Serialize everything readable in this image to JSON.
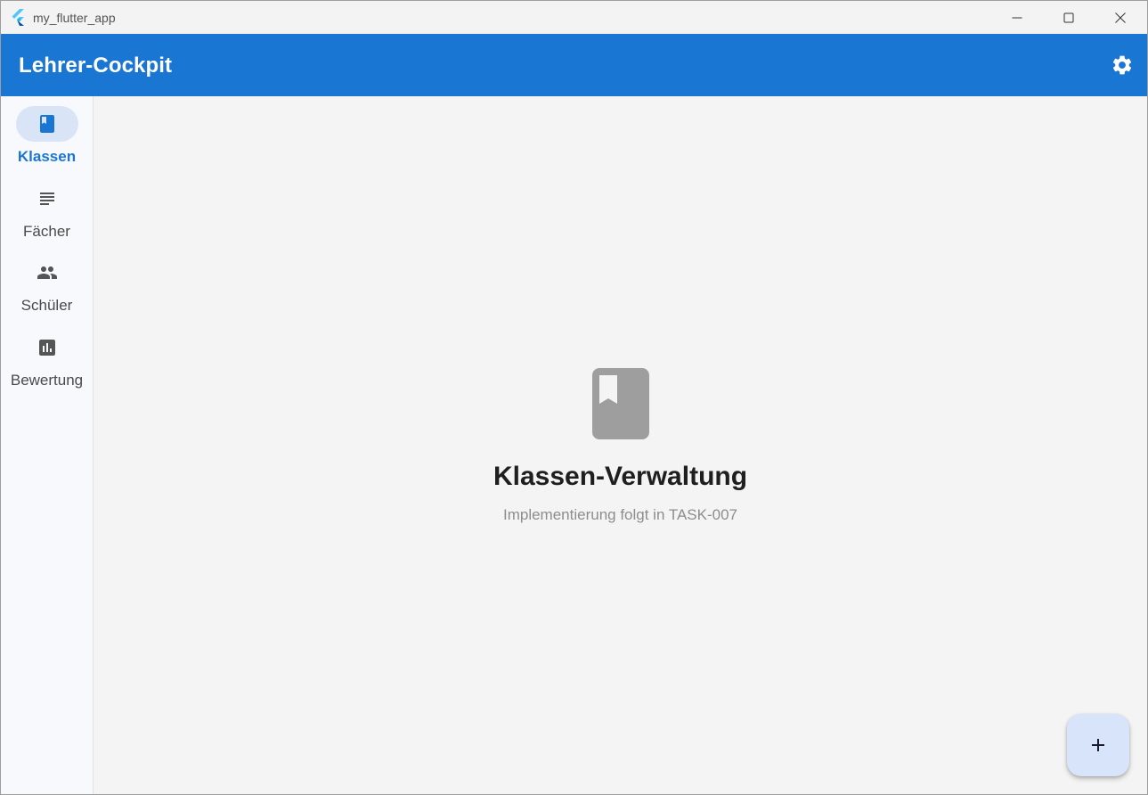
{
  "window": {
    "title": "my_flutter_app"
  },
  "appbar": {
    "title": "Lehrer-Cockpit",
    "settings_icon": "gear-icon",
    "color": "#1976d2"
  },
  "rail": {
    "items": [
      {
        "label": "Klassen",
        "icon": "book-icon",
        "active": true
      },
      {
        "label": "Fächer",
        "icon": "subject-icon",
        "active": false
      },
      {
        "label": "Schüler",
        "icon": "people-icon",
        "active": false
      },
      {
        "label": "Bewertung",
        "icon": "bar-chart-icon",
        "active": false
      }
    ]
  },
  "main": {
    "title": "Klassen-Verwaltung",
    "subtitle": "Implementierung folgt in TASK-007",
    "icon": "book-icon"
  },
  "fab": {
    "icon": "plus-icon"
  }
}
